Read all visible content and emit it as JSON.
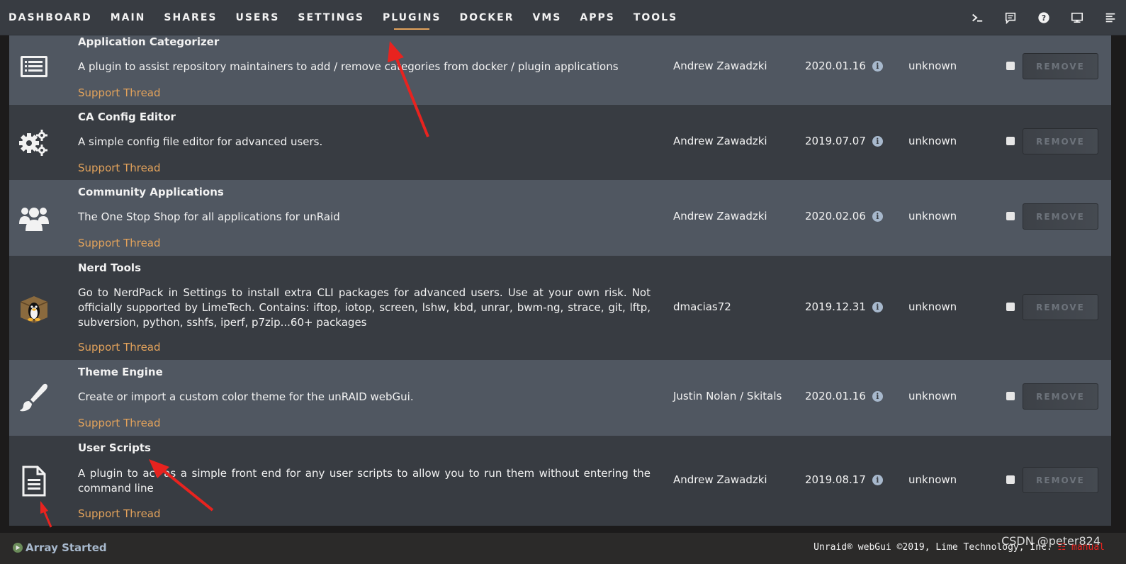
{
  "nav": {
    "items": [
      {
        "label": "DASHBOARD",
        "active": false
      },
      {
        "label": "MAIN",
        "active": false
      },
      {
        "label": "SHARES",
        "active": false
      },
      {
        "label": "USERS",
        "active": false
      },
      {
        "label": "SETTINGS",
        "active": false
      },
      {
        "label": "PLUGINS",
        "active": true
      },
      {
        "label": "DOCKER",
        "active": false
      },
      {
        "label": "VMS",
        "active": false
      },
      {
        "label": "APPS",
        "active": false
      },
      {
        "label": "TOOLS",
        "active": false
      }
    ],
    "icons": [
      "terminal-icon",
      "feedback-icon",
      "help-icon",
      "monitor-icon",
      "log-icon"
    ]
  },
  "plugins": [
    {
      "name": "Application Categorizer",
      "description": "A plugin to assist repository maintainers to add / remove categories from docker / plugin applications",
      "support": "Support Thread",
      "author": "Andrew Zawadzki",
      "version": "2020.01.16",
      "status": "unknown",
      "remove_label": "REMOVE",
      "icon": "list-icon"
    },
    {
      "name": "CA Config Editor",
      "description": "A simple config file editor for advanced users.",
      "support": "Support Thread",
      "author": "Andrew Zawadzki",
      "version": "2019.07.07",
      "status": "unknown",
      "remove_label": "REMOVE",
      "icon": "gears-icon"
    },
    {
      "name": "Community Applications",
      "description": "The One Stop Shop for all applications for unRaid",
      "support": "Support Thread",
      "author": "Andrew Zawadzki",
      "version": "2020.02.06",
      "status": "unknown",
      "remove_label": "REMOVE",
      "icon": "users-icon"
    },
    {
      "name": "Nerd Tools",
      "description": "Go to NerdPack in Settings to install extra CLI packages for advanced users. Use at your own risk. Not officially supported by LimeTech. Contains: iftop, iotop, screen, lshw, kbd, unrar, bwm-ng, strace, git, lftp, subversion, python, sshfs, iperf, p7zip...60+ packages",
      "support": "Support Thread",
      "author": "dmacias72",
      "version": "2019.12.31",
      "status": "unknown",
      "remove_label": "REMOVE",
      "icon": "tux-box-icon"
    },
    {
      "name": "Theme Engine",
      "description": "Create or import a custom color theme for the unRAID webGui.",
      "support": "Support Thread",
      "author": "Justin Nolan / Skitals",
      "version": "2020.01.16",
      "status": "unknown",
      "remove_label": "REMOVE",
      "icon": "paintbrush-icon"
    },
    {
      "name": "User Scripts",
      "description": "A plugin to act as a simple front end for any user scripts to allow you to run them without entering the command line",
      "support": "Support Thread",
      "author": "Andrew Zawadzki",
      "version": "2019.08.17",
      "status": "unknown",
      "remove_label": "REMOVE",
      "icon": "document-icon"
    }
  ],
  "footer": {
    "array_status": "Array Started",
    "copyright": "Unraid® webGui ©2019, Lime Technology, Inc.",
    "manual": "manual",
    "watermark": "CSDN @peter824"
  },
  "colors": {
    "accent": "#e2a25b",
    "row_light": "#505761",
    "row_dark": "#383c42",
    "annotation": "#e8231f"
  }
}
